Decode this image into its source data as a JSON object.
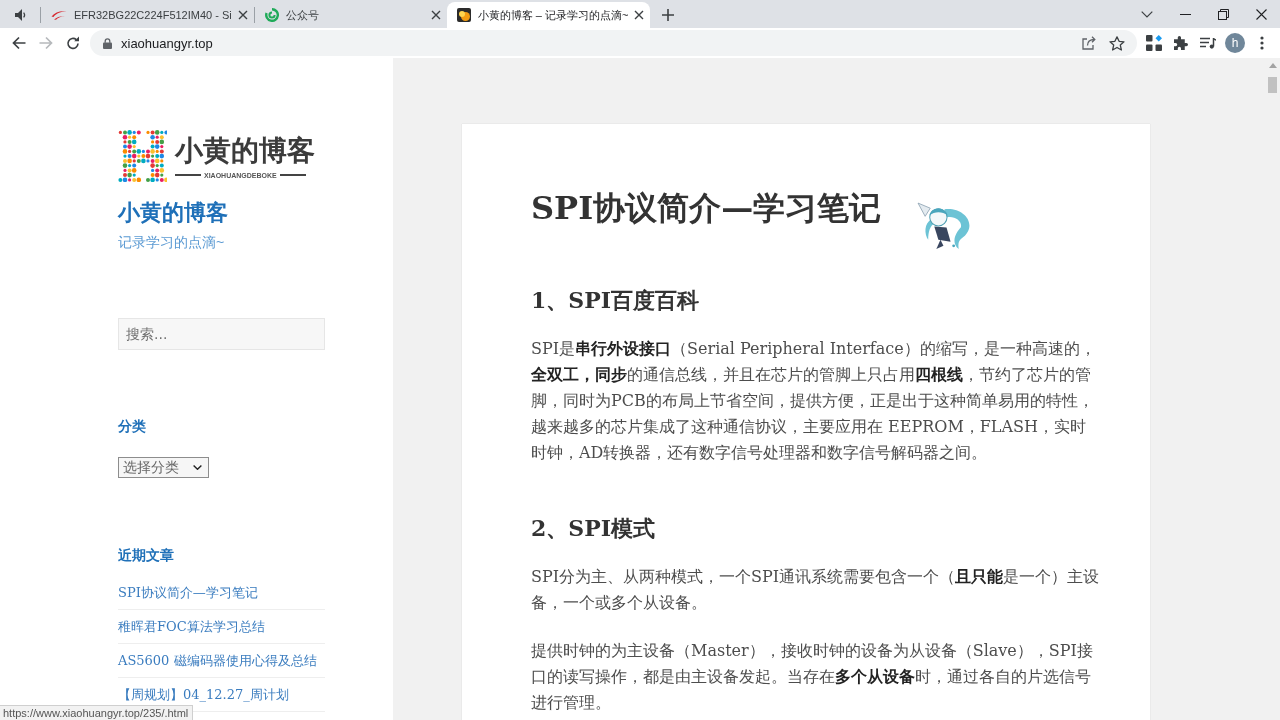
{
  "browser": {
    "tabs": [
      {
        "kind": "pinned",
        "selected": false
      },
      {
        "kind": "page",
        "title": "EFR32BG22C224F512IM40 - Si",
        "selected": false
      },
      {
        "kind": "page",
        "title": "公众号",
        "selected": false
      },
      {
        "kind": "page",
        "title": "小黄的博客 – 记录学习的点滴~",
        "selected": true
      }
    ],
    "nav_buttons": [
      {
        "kind": "back",
        "disabled": false
      },
      {
        "kind": "forward",
        "disabled": true
      },
      {
        "kind": "reload",
        "disabled": false
      }
    ],
    "address": "xiaohuangyr.top",
    "profile_initial": "h",
    "status_url": "https://www.xiaohuangyr.top/235/.html"
  },
  "sidebar": {
    "logo": {
      "title": "小黄的博客",
      "subtitle": "XIAOHUANGDEBOKE"
    },
    "site_title": "小黄的博客",
    "tagline": "记录学习的点滴~",
    "search": {
      "placeholder": "搜索..."
    },
    "categories": {
      "heading": "分类",
      "select_value": "选择分类"
    },
    "recent_posts": {
      "heading": "近期文章",
      "items": [
        "SPI协议简介—学习笔记",
        "稚晖君FOC算法学习总结",
        "AS5600 磁编码器使用心得及总结",
        "【周规划】04_12.27_周计划"
      ]
    }
  },
  "article": {
    "title": "SPI协议简介—学习笔记",
    "sections": [
      {
        "heading": "1、SPI百度百科",
        "paragraphs": [
          "SPI是**串行外设接口**（Serial Peripheral Interface）的缩写，是一种高速的，**全双工，同步**的通信总线，并且在芯片的管脚上只占用**四根线**，节约了芯片的管脚，同时为PCB的布局上节省空间，提供方便，正是出于这种简单易用的特性，越来越多的芯片集成了这种通信协议，主要应用在 EEPROM，FLASH，实时时钟，AD转换器，还有数字信号处理器和数字信号解码器之间。"
        ]
      },
      {
        "heading": "2、SPI模式",
        "paragraphs": [
          "SPI分为主、从两种模式，一个SPI通讯系统需要包含一个（**且只能**是一个）主设备，一个或多个从设备。",
          "提供时钟的为主设备（Master），接收时钟的设备为从设备（Slave），SPI接口的读写操作，都是由主设备发起。当存在**多个从设备**时，通过各自的片选信号进行管理。"
        ]
      }
    ]
  }
}
